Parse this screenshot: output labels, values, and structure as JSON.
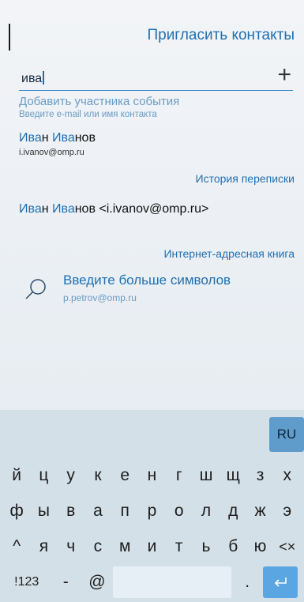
{
  "header": {
    "title": "Пригласить контакты"
  },
  "search": {
    "value": "ива"
  },
  "hint": {
    "title": "Добавить участника события",
    "subtitle": "Введите e-mail или имя контакта"
  },
  "contact": {
    "name_part1": "Ива",
    "name_part2": "н ",
    "name_part3": "Ива",
    "name_part4": "нов",
    "email": "i.ivanov@omp.ru"
  },
  "history": {
    "header": "История переписки",
    "item_hl1": "Ива",
    "item_rest1": "н ",
    "item_hl2": "Ива",
    "item_rest2": "нов <i.ivanov@omp.ru>"
  },
  "internet": {
    "header": "Интернет-адресная книга",
    "title": "Введите больше символов",
    "subtitle": "p.petrov@omp.ru"
  },
  "keyboard": {
    "lang": "RU",
    "row1": [
      "й",
      "ц",
      "у",
      "к",
      "е",
      "н",
      "г",
      "ш",
      "щ",
      "з",
      "х"
    ],
    "row2": [
      "ф",
      "ы",
      "в",
      "а",
      "п",
      "р",
      "о",
      "л",
      "д",
      "ж",
      "э"
    ],
    "row3": [
      "^",
      "я",
      "ч",
      "с",
      "м",
      "и",
      "т",
      "ь",
      "б",
      "ю",
      "<×"
    ],
    "num": "!123",
    "dash": "-",
    "at": "@",
    "dot": "."
  }
}
